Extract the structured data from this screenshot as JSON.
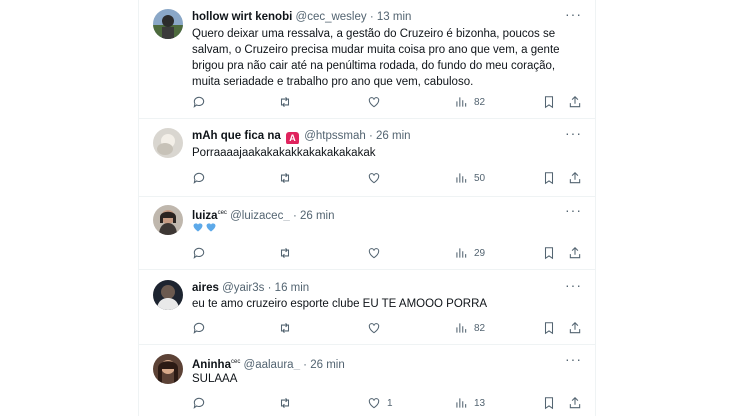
{
  "tweets": [
    {
      "name": "hollow wirt kenobi",
      "handle": "@cec_wesley",
      "dot": "·",
      "time": "13 min",
      "text": "Quero deixar uma ressalva, a gestão do Cruzeiro é bizonha, poucos se salvam, o Cruzeiro precisa mudar muita coisa pro ano que vem, a gente brigou pra não cair até na penúltima rodada, do fundo do meu coração, muita seriadade e trabalho pro ano que vem, cabuloso.",
      "likes": "",
      "views": "82"
    },
    {
      "name": "mAh que fica na",
      "badge": "A",
      "handle": "@htpssmah",
      "dot": "·",
      "time": "26 min",
      "text": "Porraaaajaakakakakkakakakakakak",
      "likes": "",
      "views": "50"
    },
    {
      "name": "luiza",
      "name_sup": "cec",
      "handle": "@luizacec_",
      "dot": "·",
      "time": "26 min",
      "text": "",
      "likes": "",
      "views": "29"
    },
    {
      "name": "aires",
      "handle": "@yair3s",
      "dot": "·",
      "time": "16 min",
      "text": "eu te amo cruzeiro esporte clube EU TE AMOOO PORRA",
      "likes": "",
      "views": "82"
    },
    {
      "name": "Aninha",
      "name_sup": "cec",
      "handle": "@aalaura_",
      "dot": "·",
      "time": "26 min",
      "text": "SULAAA",
      "likes": "1",
      "views": "13"
    }
  ],
  "icons": {
    "reply": "reply-icon",
    "retweet": "retweet-icon",
    "like": "heart-icon",
    "views": "views-icon",
    "bookmark": "bookmark-icon",
    "share": "share-icon",
    "more": "more-icon"
  },
  "colors": {
    "text": "#0f1419",
    "muted": "#536471",
    "border": "#eff3f4",
    "heart_emoji": "#5da9e9",
    "badge": "#e0245e"
  }
}
